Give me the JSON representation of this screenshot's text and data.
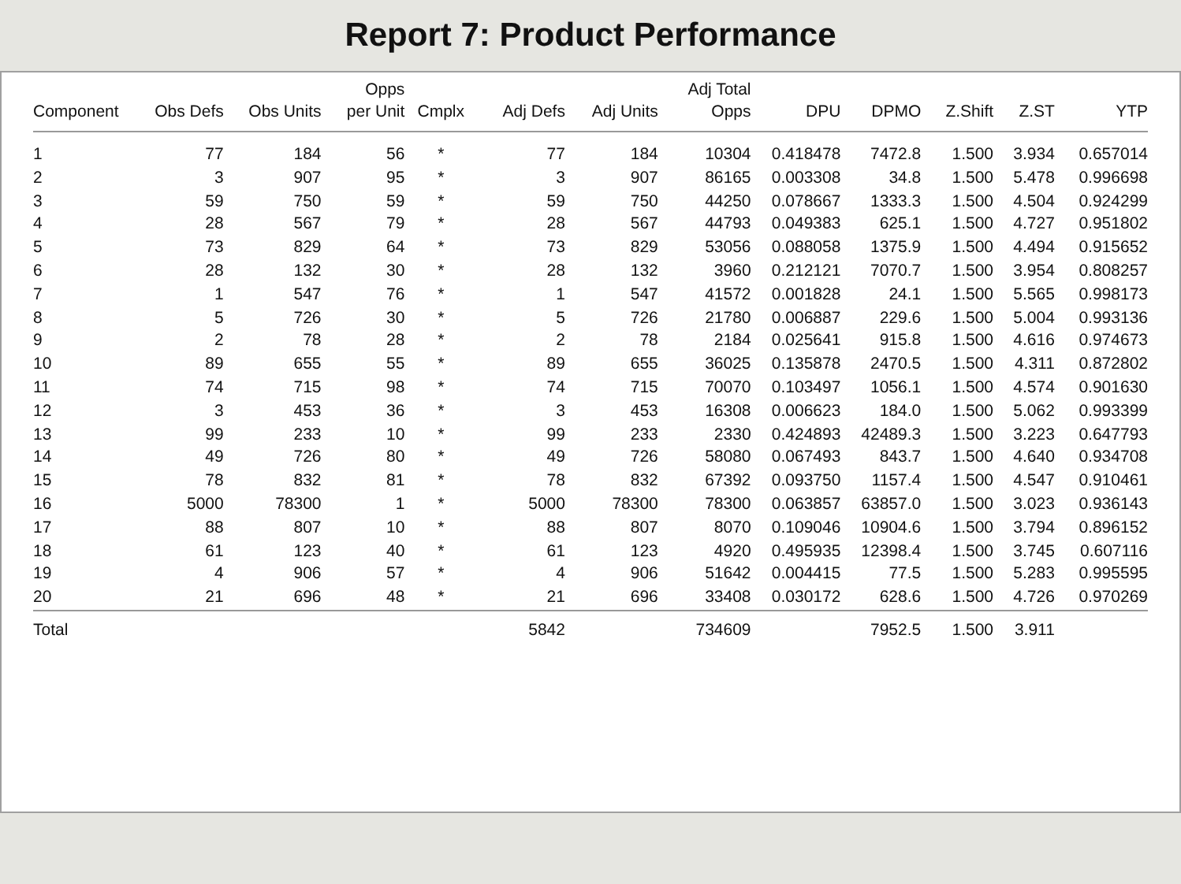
{
  "title": "Report 7: Product Performance",
  "table": {
    "columns": [
      "Component",
      "Obs Defs",
      "Obs Units",
      "Opps\nper Unit",
      "Cmplx",
      "Adj Defs",
      "Adj Units",
      "Adj Total\nOpps",
      "DPU",
      "DPMO",
      "Z.Shift",
      "Z.ST",
      "YTP"
    ],
    "rows": [
      [
        "1",
        "77",
        "184",
        "56",
        "*",
        "77",
        "184",
        "10304",
        "0.418478",
        "7472.8",
        "1.500",
        "3.934",
        "0.657014"
      ],
      [
        "2",
        "3",
        "907",
        "95",
        "*",
        "3",
        "907",
        "86165",
        "0.003308",
        "34.8",
        "1.500",
        "5.478",
        "0.996698"
      ],
      [
        "3",
        "59",
        "750",
        "59",
        "*",
        "59",
        "750",
        "44250",
        "0.078667",
        "1333.3",
        "1.500",
        "4.504",
        "0.924299"
      ],
      [
        "4",
        "28",
        "567",
        "79",
        "*",
        "28",
        "567",
        "44793",
        "0.049383",
        "625.1",
        "1.500",
        "4.727",
        "0.951802"
      ],
      [
        "5",
        "73",
        "829",
        "64",
        "*",
        "73",
        "829",
        "53056",
        "0.088058",
        "1375.9",
        "1.500",
        "4.494",
        "0.915652"
      ],
      [
        "6",
        "28",
        "132",
        "30",
        "*",
        "28",
        "132",
        "3960",
        "0.212121",
        "7070.7",
        "1.500",
        "3.954",
        "0.808257"
      ],
      [
        "7",
        "1",
        "547",
        "76",
        "*",
        "1",
        "547",
        "41572",
        "0.001828",
        "24.1",
        "1.500",
        "5.565",
        "0.998173"
      ],
      [
        "8",
        "5",
        "726",
        "30",
        "*",
        "5",
        "726",
        "21780",
        "0.006887",
        "229.6",
        "1.500",
        "5.004",
        "0.993136"
      ],
      [
        "9",
        "2",
        "78",
        "28",
        "*",
        "2",
        "78",
        "2184",
        "0.025641",
        "915.8",
        "1.500",
        "4.616",
        "0.974673"
      ],
      [
        "10",
        "89",
        "655",
        "55",
        "*",
        "89",
        "655",
        "36025",
        "0.135878",
        "2470.5",
        "1.500",
        "4.311",
        "0.872802"
      ],
      [
        "11",
        "74",
        "715",
        "98",
        "*",
        "74",
        "715",
        "70070",
        "0.103497",
        "1056.1",
        "1.500",
        "4.574",
        "0.901630"
      ],
      [
        "12",
        "3",
        "453",
        "36",
        "*",
        "3",
        "453",
        "16308",
        "0.006623",
        "184.0",
        "1.500",
        "5.062",
        "0.993399"
      ],
      [
        "13",
        "99",
        "233",
        "10",
        "*",
        "99",
        "233",
        "2330",
        "0.424893",
        "42489.3",
        "1.500",
        "3.223",
        "0.647793"
      ],
      [
        "14",
        "49",
        "726",
        "80",
        "*",
        "49",
        "726",
        "58080",
        "0.067493",
        "843.7",
        "1.500",
        "4.640",
        "0.934708"
      ],
      [
        "15",
        "78",
        "832",
        "81",
        "*",
        "78",
        "832",
        "67392",
        "0.093750",
        "1157.4",
        "1.500",
        "4.547",
        "0.910461"
      ],
      [
        "16",
        "5000",
        "78300",
        "1",
        "*",
        "5000",
        "78300",
        "78300",
        "0.063857",
        "63857.0",
        "1.500",
        "3.023",
        "0.936143"
      ],
      [
        "17",
        "88",
        "807",
        "10",
        "*",
        "88",
        "807",
        "8070",
        "0.109046",
        "10904.6",
        "1.500",
        "3.794",
        "0.896152"
      ],
      [
        "18",
        "61",
        "123",
        "40",
        "*",
        "61",
        "123",
        "4920",
        "0.495935",
        "12398.4",
        "1.500",
        "3.745",
        "0.607116"
      ],
      [
        "19",
        "4",
        "906",
        "57",
        "*",
        "4",
        "906",
        "51642",
        "0.004415",
        "77.5",
        "1.500",
        "5.283",
        "0.995595"
      ],
      [
        "20",
        "21",
        "696",
        "48",
        "*",
        "21",
        "696",
        "33408",
        "0.030172",
        "628.6",
        "1.500",
        "4.726",
        "0.970269"
      ]
    ],
    "total": {
      "label": "Total",
      "adj_defs": "5842",
      "adj_total_opps": "734609",
      "dpmo": "7952.5",
      "z_shift": "1.500",
      "z_st": "3.911"
    }
  }
}
